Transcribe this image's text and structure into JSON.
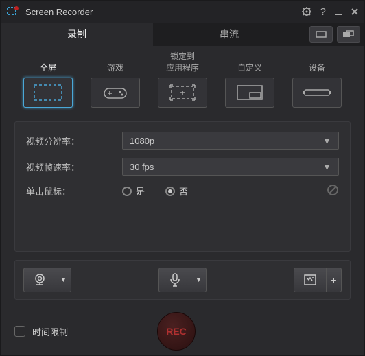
{
  "app": {
    "title": "Screen Recorder"
  },
  "tabs": {
    "record": "录制",
    "stream": "串流"
  },
  "modes": {
    "fullscreen": "全屏",
    "game": "游戏",
    "lockapp": "锁定到\n应用程序",
    "custom": "自定义",
    "device": "设备"
  },
  "settings": {
    "resolution_label": "视频分辨率：",
    "resolution_value": "1080p",
    "framerate_label": "视频帧速率：",
    "framerate_value": "30 fps",
    "clicks_label": "单击鼠标：",
    "yes": "是",
    "no": "否"
  },
  "bottom": {
    "time_limit": "时间限制",
    "rec": "REC"
  }
}
